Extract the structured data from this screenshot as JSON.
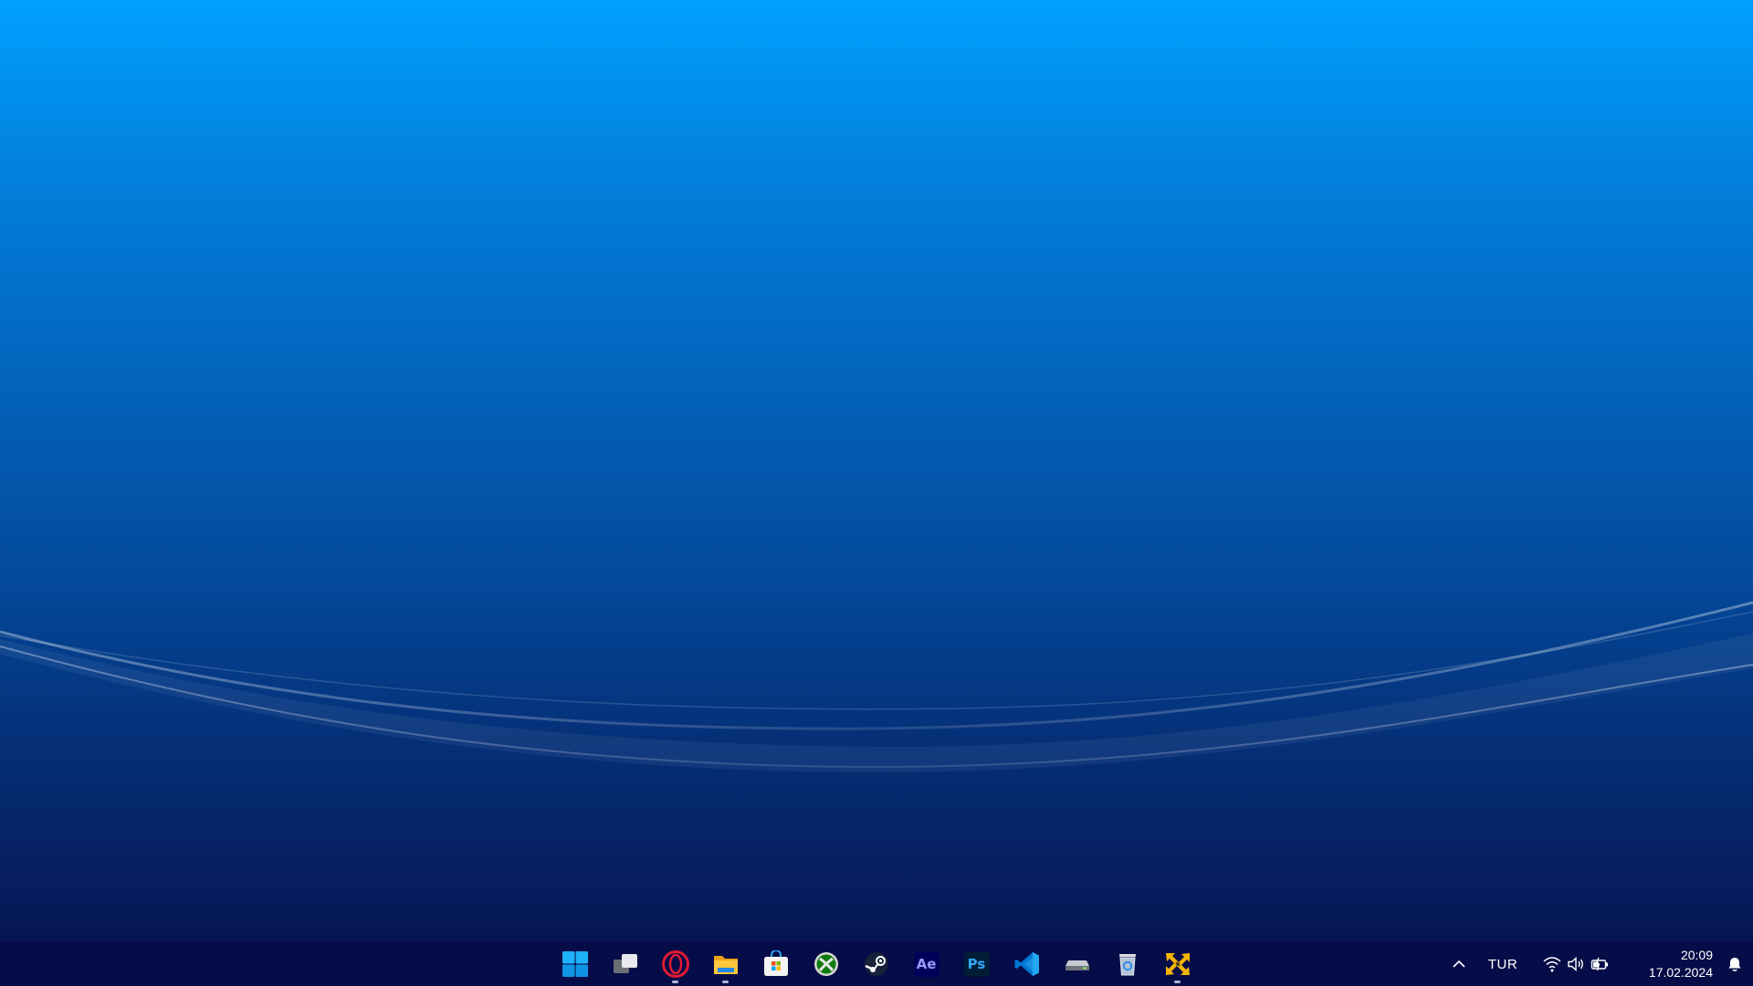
{
  "desktop": {
    "wallpaper": "blue-gradient-wave",
    "colors": {
      "top": "#019ffe",
      "bottom": "#070f4a"
    }
  },
  "taskbar": {
    "pinned": [
      {
        "name": "start-button",
        "icon": "windows-logo-icon",
        "running": false
      },
      {
        "name": "task-view-button",
        "icon": "task-view-icon",
        "running": false
      },
      {
        "name": "opera-button",
        "icon": "opera-icon",
        "running": true
      },
      {
        "name": "file-explorer-button",
        "icon": "folder-icon",
        "running": true
      },
      {
        "name": "microsoft-store-button",
        "icon": "store-bag-icon",
        "running": false
      },
      {
        "name": "xbox-button",
        "icon": "xbox-icon",
        "running": false
      },
      {
        "name": "steam-button",
        "icon": "steam-icon",
        "running": false
      },
      {
        "name": "after-effects-button",
        "icon": "after-effects-icon",
        "label": "Ae",
        "running": false
      },
      {
        "name": "photoshop-button",
        "icon": "photoshop-icon",
        "label": "Ps",
        "running": false
      },
      {
        "name": "vscode-button",
        "icon": "vscode-icon",
        "running": false
      },
      {
        "name": "drive-button",
        "icon": "drive-icon",
        "running": false
      },
      {
        "name": "recycle-bin-button",
        "icon": "recycle-bin-icon",
        "running": false
      },
      {
        "name": "yellow-app-button",
        "icon": "yellow-arrows-icon",
        "running": true
      }
    ],
    "tray": {
      "language": "TUR",
      "time": "20:09",
      "date": "17.02.2024"
    }
  }
}
